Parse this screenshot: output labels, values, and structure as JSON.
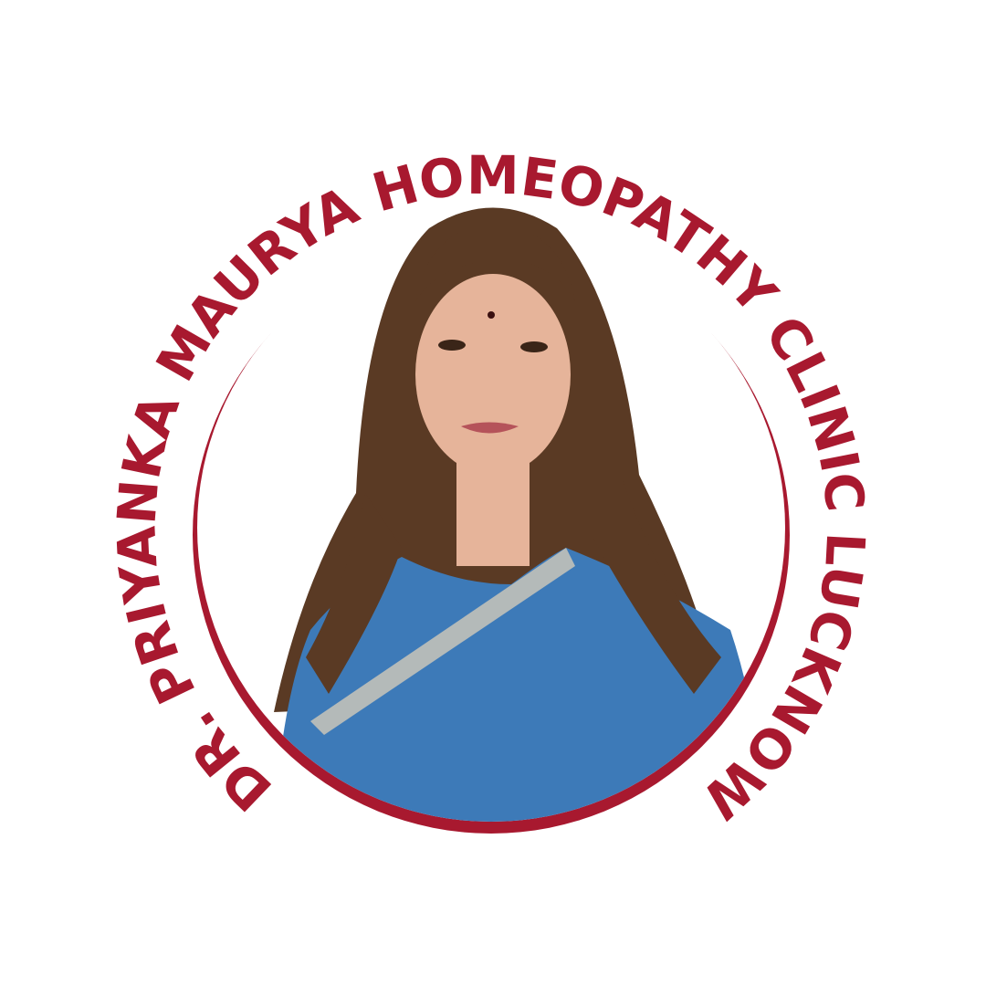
{
  "logo": {
    "circular_text": "DR. PRIYANKA MAURYA HOMEOPATHY CLINIC LUCKNOW",
    "brand_color": "#a8192f",
    "saree_color": "#3d7ab8",
    "hair_color": "#5a3a24",
    "skin_color": "#e6b49a"
  }
}
